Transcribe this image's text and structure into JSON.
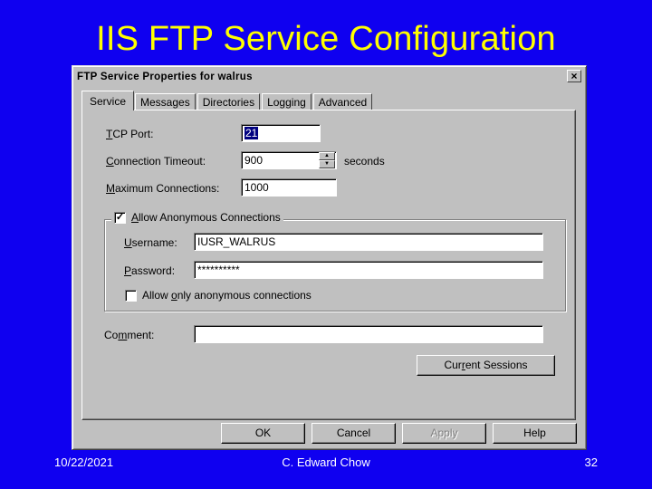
{
  "slide": {
    "title": "IIS FTP Service Configuration",
    "footer_date": "10/22/2021",
    "footer_author": "C. Edward Chow",
    "footer_page": "32"
  },
  "dialog": {
    "title": "FTP Service Properties for walrus",
    "close_glyph": "×",
    "tabs": [
      {
        "label": "Service",
        "active": true
      },
      {
        "label": "Messages",
        "active": false
      },
      {
        "label": "Directories",
        "active": false
      },
      {
        "label": "Logging",
        "active": false
      },
      {
        "label": "Advanced",
        "active": false
      }
    ],
    "service": {
      "tcp_port_label_pre": "",
      "tcp_port_label_hot": "T",
      "tcp_port_label_post": "CP Port:",
      "tcp_port_value": "21",
      "conn_timeout_label_pre": "",
      "conn_timeout_label_hot": "C",
      "conn_timeout_label_post": "onnection Timeout:",
      "conn_timeout_value": "900",
      "conn_timeout_unit": "seconds",
      "max_conn_label_pre": "",
      "max_conn_label_hot": "M",
      "max_conn_label_post": "aximum Connections:",
      "max_conn_value": "1000",
      "allow_anon_checked": true,
      "allow_anon_label_pre": "",
      "allow_anon_label_hot": "A",
      "allow_anon_label_post": "llow Anonymous Connections",
      "username_label_pre": "",
      "username_label_hot": "U",
      "username_label_post": "sername:",
      "username_value": "IUSR_WALRUS",
      "password_label_pre": "",
      "password_label_hot": "P",
      "password_label_post": "assword:",
      "password_value": "**********",
      "anon_only_checked": false,
      "anon_only_label_pre": "Allow ",
      "anon_only_label_hot": "o",
      "anon_only_label_post": "nly anonymous connections",
      "comment_label_pre": "Co",
      "comment_label_hot": "m",
      "comment_label_post": "ment:",
      "comment_value": "",
      "current_sessions_pre": "Cur",
      "current_sessions_hot": "r",
      "current_sessions_post": "ent Sessions"
    },
    "buttons": {
      "ok": "OK",
      "cancel": "Cancel",
      "apply": "Apply",
      "help": "Help"
    }
  }
}
